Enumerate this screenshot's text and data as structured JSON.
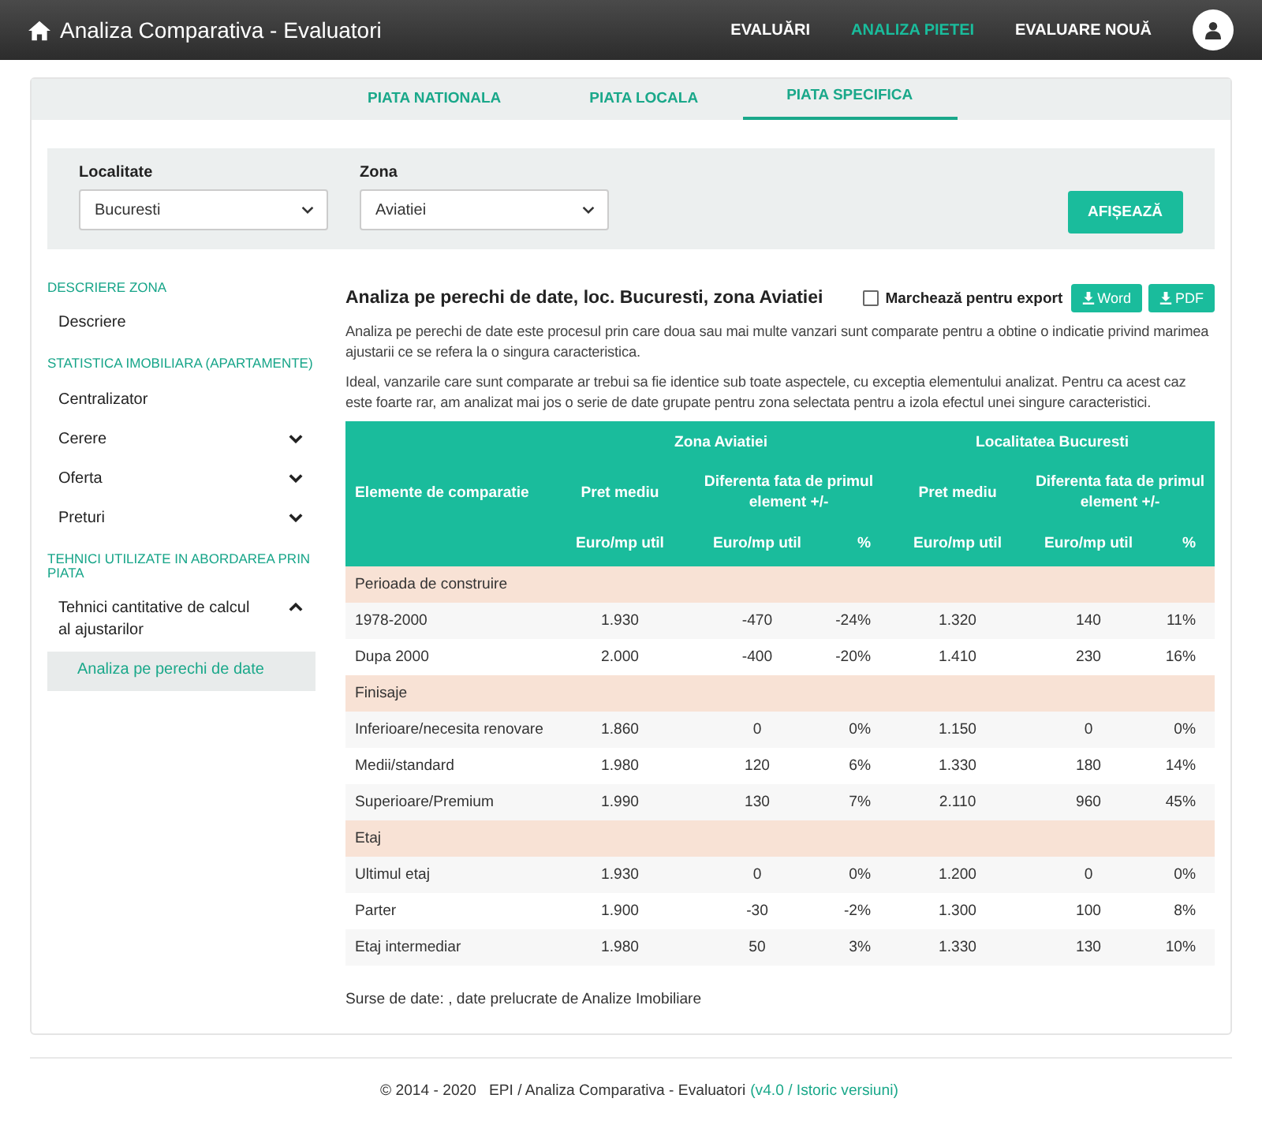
{
  "nav": {
    "title": "Analiza Comparativa - Evaluatori",
    "links": [
      {
        "label": "EVALUĂRI",
        "selected": false
      },
      {
        "label": "ANALIZA PIETEI",
        "selected": true
      },
      {
        "label": "EVALUARE NOUĂ",
        "selected": false
      }
    ]
  },
  "tabs": [
    {
      "label": "PIATA NATIONALA",
      "selected": false
    },
    {
      "label": "PIATA LOCALA",
      "selected": false
    },
    {
      "label": "PIATA SPECIFICA",
      "selected": true
    }
  ],
  "filters": [
    {
      "label": "Localitate",
      "value": "Bucuresti"
    },
    {
      "label": "Zona",
      "value": "Aviatiei"
    }
  ],
  "show_button": "AFIȘEAZĂ",
  "sidebar": [
    {
      "heading": "DESCRIERE ZONA",
      "items": [
        {
          "label": "Descriere",
          "kind": "link",
          "selected": false
        }
      ]
    },
    {
      "heading": "STATISTICA IMOBILIARA (APARTAMENTE)",
      "items": [
        {
          "label": "Centralizator",
          "kind": "link",
          "selected": false
        },
        {
          "label": "Cerere",
          "kind": "group",
          "expanded": false,
          "selected": false
        },
        {
          "label": "Oferta",
          "kind": "group",
          "expanded": false,
          "selected": false
        },
        {
          "label": "Preturi",
          "kind": "group",
          "expanded": false,
          "selected": false
        }
      ]
    },
    {
      "heading": "TEHNICI UTILIZATE IN ABORDAREA PRIN PIATA",
      "items": [
        {
          "label": "Tehnici cantitative de calcul al ajustarilor",
          "kind": "group",
          "expanded": true,
          "selected": false,
          "children": [
            {
              "label": "Analiza pe perechi de date",
              "selected": true
            }
          ]
        }
      ]
    }
  ],
  "content": {
    "title": "Analiza pe perechi de date, loc. Bucuresti, zona Aviatiei",
    "export": {
      "label": "Marchează pentru export",
      "checked": false
    },
    "export_buttons": [
      "Word",
      "PDF"
    ],
    "paragraphs": [
      "Analiza pe perechi de date este procesul prin care doua sau mai multe vanzari sunt comparate pentru a obtine o indicatie privind marimea ajustarii ce se refera la o singura caracteristica.",
      "Ideal, vanzarile care sunt comparate ar trebui sa fie identice sub toate aspectele, cu exceptia elementului analizat. Pentru ca acest caz este foarte rar, am analizat mai jos o serie de date grupate pentru zona selectata pentru a izola efectul unei singure caracteristici."
    ],
    "table": {
      "first_column": "Elemente de comparatie",
      "groups": [
        {
          "label": "Zona Aviatiei",
          "columns": [
            "Pret mediu",
            "Diferenta fata de primul element +/-"
          ],
          "units": [
            "Euro/mp util",
            "Euro/mp util",
            "%"
          ]
        },
        {
          "label": "Localitatea Bucuresti",
          "columns": [
            "Pret mediu",
            "Diferenta fata de primul element +/-"
          ],
          "units": [
            "Euro/mp util",
            "Euro/mp util",
            "%"
          ]
        }
      ],
      "rows": [
        {
          "kind": "section",
          "label": "Perioada de construire"
        },
        {
          "kind": "data",
          "cells": [
            "1978-2000",
            "1.930",
            "-470",
            "-24%",
            "1.320",
            "140",
            "11%"
          ]
        },
        {
          "kind": "data",
          "cells": [
            "Dupa 2000",
            "2.000",
            "-400",
            "-20%",
            "1.410",
            "230",
            "16%"
          ]
        },
        {
          "kind": "section",
          "label": "Finisaje"
        },
        {
          "kind": "data",
          "cells": [
            "Inferioare/necesita renovare",
            "1.860",
            "0",
            "0%",
            "1.150",
            "0",
            "0%"
          ]
        },
        {
          "kind": "data",
          "cells": [
            "Medii/standard",
            "1.980",
            "120",
            "6%",
            "1.330",
            "180",
            "14%"
          ]
        },
        {
          "kind": "data",
          "cells": [
            "Superioare/Premium",
            "1.990",
            "130",
            "7%",
            "2.110",
            "960",
            "45%"
          ]
        },
        {
          "kind": "section",
          "label": "Etaj"
        },
        {
          "kind": "data",
          "cells": [
            "Ultimul etaj",
            "1.930",
            "0",
            "0%",
            "1.200",
            "0",
            "0%"
          ]
        },
        {
          "kind": "data",
          "cells": [
            "Parter",
            "1.900",
            "-30",
            "-2%",
            "1.300",
            "100",
            "8%"
          ]
        },
        {
          "kind": "data",
          "cells": [
            "Etaj intermediar",
            "1.980",
            "50",
            "3%",
            "1.330",
            "130",
            "10%"
          ]
        }
      ]
    },
    "source": "Surse de date: , date prelucrate de Analize Imobiliare"
  },
  "footer": {
    "text": "© 2014 - 2020   EPI / Analiza Comparativa - Evaluatori",
    "link": "(v4.0 / Istoric versiuni)"
  }
}
